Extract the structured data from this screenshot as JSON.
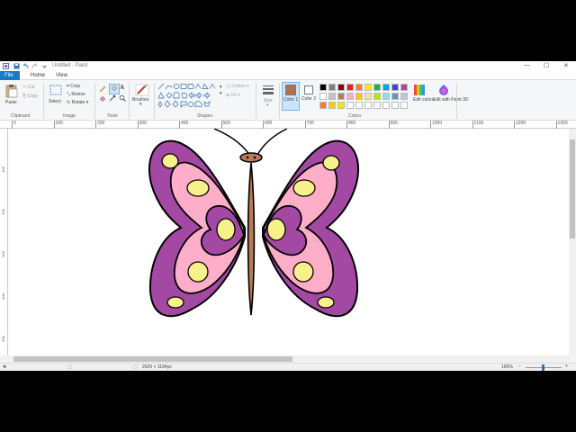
{
  "window": {
    "title": "Untitled - Paint",
    "minimize": "—",
    "maximize": "☐",
    "close": "✕"
  },
  "tabs": {
    "file": "File",
    "home": "Home",
    "view": "View"
  },
  "clipboard": {
    "paste": "Paste",
    "cut": "Cut",
    "copy": "Copy",
    "label": "Clipboard"
  },
  "image": {
    "select": "Select",
    "crop": "Crop",
    "resize": "Resize",
    "rotate": "Rotate",
    "label": "Image"
  },
  "tools": {
    "label": "Tools",
    "text_tool": "A"
  },
  "brushes": {
    "label": "Brushes"
  },
  "shapes": {
    "outline": "Outline",
    "fill": "Fill",
    "label": "Shapes"
  },
  "size": {
    "label": "Size"
  },
  "colors": {
    "color1": "Color 1",
    "color2": "Color 2",
    "label": "Colors",
    "edit_colors": "Edit colors",
    "edit_paint3d": "Edit with Paint 3D",
    "color1_value": "#b5704e",
    "color2_value": "#ffffff",
    "palette": [
      "#000000",
      "#7f7f7f",
      "#880015",
      "#ed1c24",
      "#ff7f27",
      "#fff200",
      "#22b14c",
      "#00a2e8",
      "#3f48cc",
      "#a349a4",
      "#ffffff",
      "#c3c3c3",
      "#b97a57",
      "#ffaec9",
      "#ffc90e",
      "#efe4b0",
      "#b5e61d",
      "#99d9ea",
      "#7092be",
      "#c8bfe7",
      "#ff7f27",
      "#ffc90e",
      "#f7e600",
      "#ffffff",
      "#ffffff",
      "#ffffff",
      "#ffffff",
      "#ffffff",
      "#ffffff",
      "#ffffff"
    ]
  },
  "ruler": {
    "ticks": [
      "0",
      "100",
      "200",
      "300",
      "400",
      "500",
      "600",
      "700",
      "800",
      "900",
      "1000",
      "1100",
      "1200",
      "1300"
    ],
    "vticks": [
      "100",
      "200",
      "300",
      "400",
      "500"
    ]
  },
  "status": {
    "dimensions": "2626 × 1194px",
    "zoom": "100%"
  },
  "drawing": {
    "wing_fill": "#a349a4",
    "inner_fill": "#ffaec9",
    "spot_fill": "#f8f08a",
    "body_fill": "#b97a57"
  }
}
